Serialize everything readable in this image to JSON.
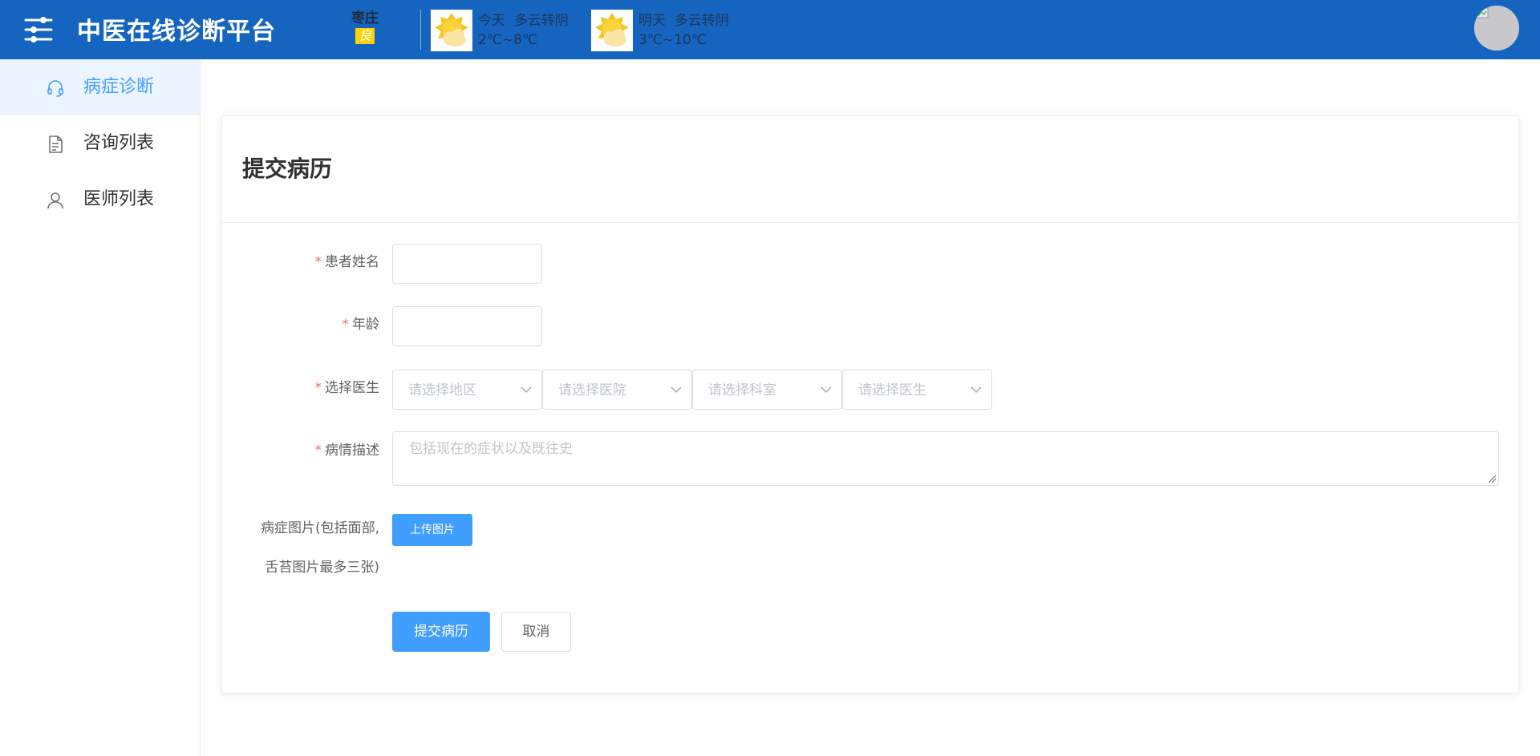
{
  "header": {
    "app_title": "中医在线诊断平台",
    "menu_icon": "sliders-icon",
    "city": "枣庄",
    "air_quality": "良",
    "weather_today": {
      "day": "今天",
      "condition": "多云转阴",
      "temp": "2℃~8℃",
      "icon": "partly-cloudy-icon"
    },
    "weather_tomorrow": {
      "day": "明天",
      "condition": "多云转阴",
      "temp": "3℃~10℃",
      "icon": "partly-cloudy-icon"
    },
    "avatar_icon": "avatar-icon"
  },
  "sidebar": {
    "items": [
      {
        "label": "病症诊断",
        "icon": "headset-icon",
        "active": true
      },
      {
        "label": "咨询列表",
        "icon": "document-icon",
        "active": false
      },
      {
        "label": "医师列表",
        "icon": "user-icon",
        "active": false
      }
    ]
  },
  "form": {
    "title": "提交病历",
    "required_mark": "*",
    "patient_name": {
      "label": "患者姓名",
      "value": ""
    },
    "age": {
      "label": "年龄",
      "value": ""
    },
    "doctor": {
      "label": "选择医生",
      "region_placeholder": "请选择地区",
      "hospital_placeholder": "请选择医院",
      "department_placeholder": "请选择科室",
      "doctor_placeholder": "请选择医生"
    },
    "description": {
      "label": "病情描述",
      "placeholder": "包括现在的症状以及既往史"
    },
    "images": {
      "label_line1": "病症图片(包括面部,",
      "label_line2": "舌苔图片最多三张)",
      "upload_label": "上传图片"
    },
    "submit_label": "提交病历",
    "cancel_label": "取消"
  },
  "colors": {
    "header_bg": "#1565c0",
    "primary": "#409eff",
    "active_bg": "#ecf5ff",
    "required": "#f56c6c",
    "aqi_badge": "#ffd200"
  }
}
